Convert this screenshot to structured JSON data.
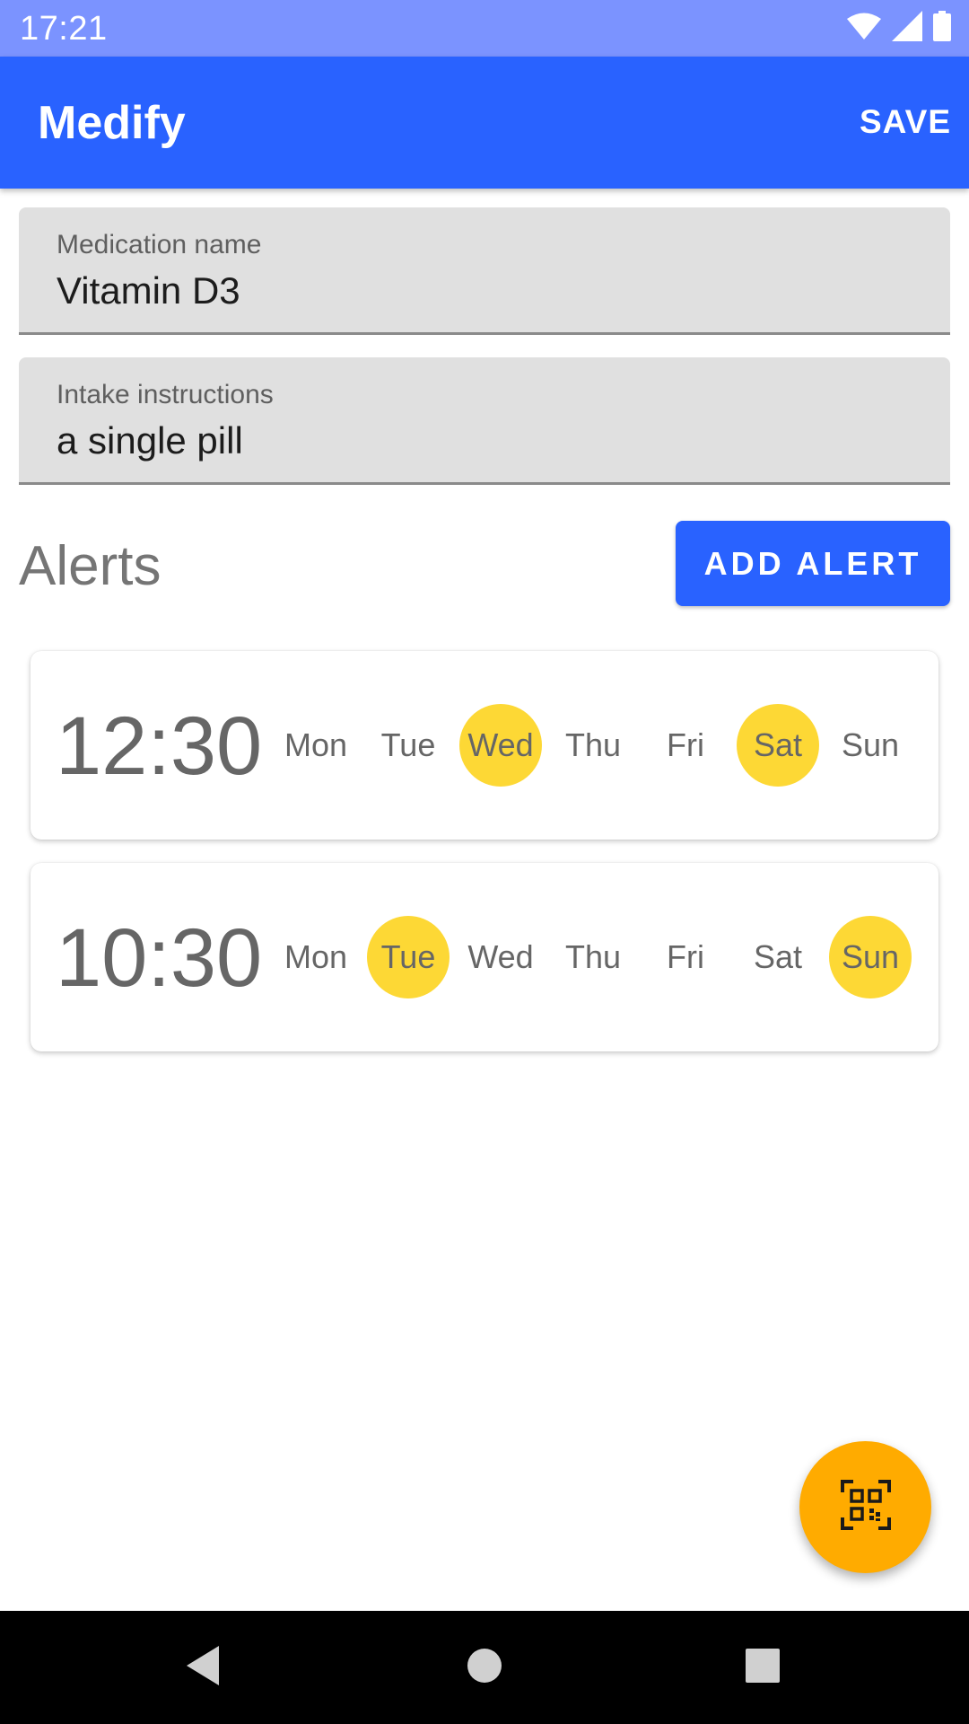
{
  "status_bar": {
    "time": "17:21",
    "icons": [
      "wifi-icon",
      "signal-icon",
      "battery-icon"
    ]
  },
  "app_bar": {
    "title": "Medify",
    "save_label": "SAVE"
  },
  "fields": {
    "medication_name": {
      "label": "Medication name",
      "value": "Vitamin D3"
    },
    "intake_instructions": {
      "label": "Intake instructions",
      "value": "a single pill"
    }
  },
  "alerts": {
    "heading": "Alerts",
    "add_label": "ADD ALERT",
    "items": [
      {
        "time": "12:30",
        "days": [
          {
            "label": "Mon",
            "selected": false
          },
          {
            "label": "Tue",
            "selected": false
          },
          {
            "label": "Wed",
            "selected": true
          },
          {
            "label": "Thu",
            "selected": false
          },
          {
            "label": "Fri",
            "selected": false
          },
          {
            "label": "Sat",
            "selected": true
          },
          {
            "label": "Sun",
            "selected": false
          }
        ]
      },
      {
        "time": "10:30",
        "days": [
          {
            "label": "Mon",
            "selected": false
          },
          {
            "label": "Tue",
            "selected": true
          },
          {
            "label": "Wed",
            "selected": false
          },
          {
            "label": "Thu",
            "selected": false
          },
          {
            "label": "Fri",
            "selected": false
          },
          {
            "label": "Sat",
            "selected": false
          },
          {
            "label": "Sun",
            "selected": true
          }
        ]
      }
    ]
  },
  "fab": {
    "icon": "qr-code-scan-icon"
  },
  "nav_bar": {
    "icons": [
      "back-icon",
      "home-icon",
      "recents-icon"
    ]
  },
  "colors": {
    "status_bar": "#7b93ff",
    "primary": "#2962ff",
    "day_selected": "#fdd835",
    "fab": "#ffab00",
    "field_background": "#e0e0e0"
  }
}
